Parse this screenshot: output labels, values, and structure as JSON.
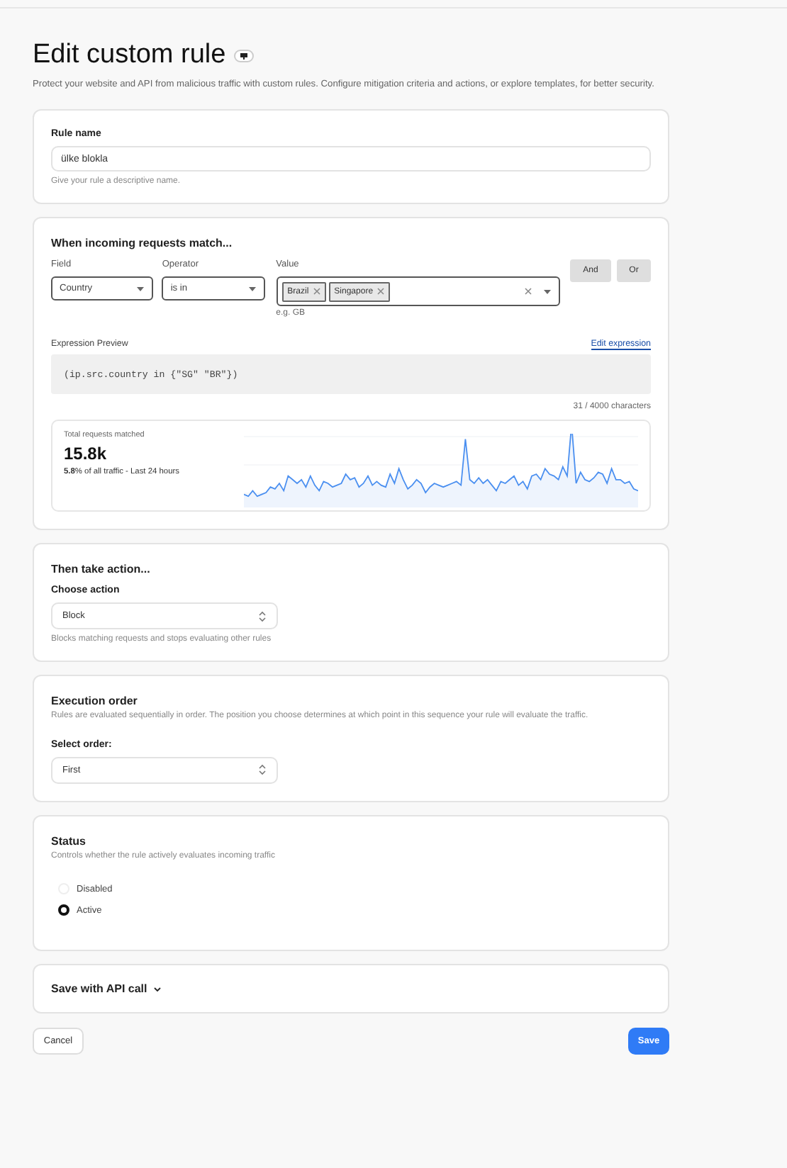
{
  "header": {
    "title": "Edit custom rule",
    "description": "Protect your website and API from malicious traffic with custom rules. Configure mitigation criteria and actions, or explore templates, for better security."
  },
  "rule_name": {
    "label": "Rule name",
    "value": "ülke blokla",
    "help": "Give your rule a descriptive name."
  },
  "match": {
    "heading": "When incoming requests match...",
    "selects": [
      {
        "label": "Field",
        "value": "Country"
      },
      {
        "label": "Operator",
        "value": "is in"
      }
    ],
    "value_field": {
      "label": "Value",
      "tags": [
        "Brazil",
        "Singapore"
      ],
      "hint": "e.g. GB"
    },
    "buttons": [
      "And",
      "Or"
    ],
    "preview": {
      "label": "Expression Preview",
      "link": "Edit expression",
      "expression": "(ip.src.country in {\"SG\" \"BR\"})",
      "count": "31 / 4000 characters"
    },
    "stats": {
      "label": "Total requests matched",
      "value": "15.8k",
      "note": "**5.8**% of all traffic - Last 24 hours"
    }
  },
  "action": {
    "heading": "Then take action...",
    "label": "Choose action",
    "value": "Block",
    "help": "Blocks matching requests and stops evaluating other rules"
  },
  "order": {
    "heading": "Execution order",
    "description": "Rules are evaluated sequentially in order. The position you choose determines at which point in this sequence your rule will evaluate the traffic.",
    "label": "Select order:",
    "value": "First"
  },
  "status": {
    "heading": "Status",
    "description": "Controls whether the rule actively evaluates incoming traffic",
    "options": [
      {
        "label": "Disabled",
        "selected": false
      },
      {
        "label": "Active",
        "selected": true
      }
    ]
  },
  "api": {
    "label": "Save with API call"
  },
  "footer": {
    "cancel": "Cancel",
    "save": "Save"
  }
}
